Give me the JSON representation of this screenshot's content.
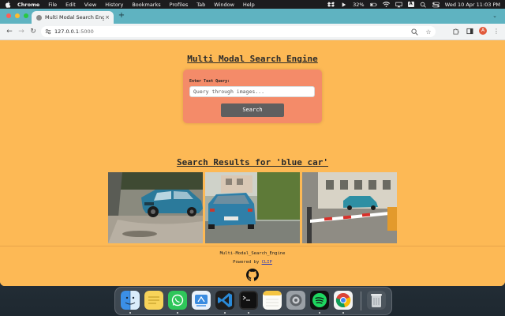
{
  "menubar": {
    "app_name": "Chrome",
    "menus": [
      "File",
      "Edit",
      "View",
      "History",
      "Bookmarks",
      "Profiles",
      "Tab",
      "Window",
      "Help"
    ],
    "battery": "32%",
    "input_source": "A",
    "clock": "Wed 10 Apr  11:03 PM"
  },
  "browser": {
    "tab_title": "Multi Modal Search Engine",
    "url_host": "127.0.0.1",
    "url_port": ":5000",
    "profile_initial": "A"
  },
  "page": {
    "title": "Multi Modal Search Engine",
    "search": {
      "label": "Enter Text Query:",
      "placeholder": "Query through images...",
      "button_label": "Search"
    },
    "results_title": "Search Results for 'blue car'",
    "results": [
      {
        "icon": "blue-car-parked-on-gravel"
      },
      {
        "icon": "blue-hatchback-rear-view"
      },
      {
        "icon": "blue-car-behind-barrier"
      }
    ],
    "footer": {
      "name": "Multi-Modal_Search_Engine",
      "powered_prefix": "Powered by ",
      "powered_link": "CLIP",
      "github_icon": "github-icon"
    }
  },
  "dock": {
    "apps": [
      "finder-icon",
      "notes-yellow-icon",
      "whatsapp-icon",
      "app-store-connect-icon",
      "vscode-icon",
      "terminal-icon",
      "notes-icon",
      "system-settings-icon",
      "spotify-icon",
      "chrome-icon",
      "trash-icon"
    ]
  },
  "colors": {
    "page_bg": "#fdb955",
    "card_bg": "#f48b69",
    "tab_strip": "#5fb3c1",
    "search_button": "#5f5f5f",
    "link": "#2a36b8"
  }
}
